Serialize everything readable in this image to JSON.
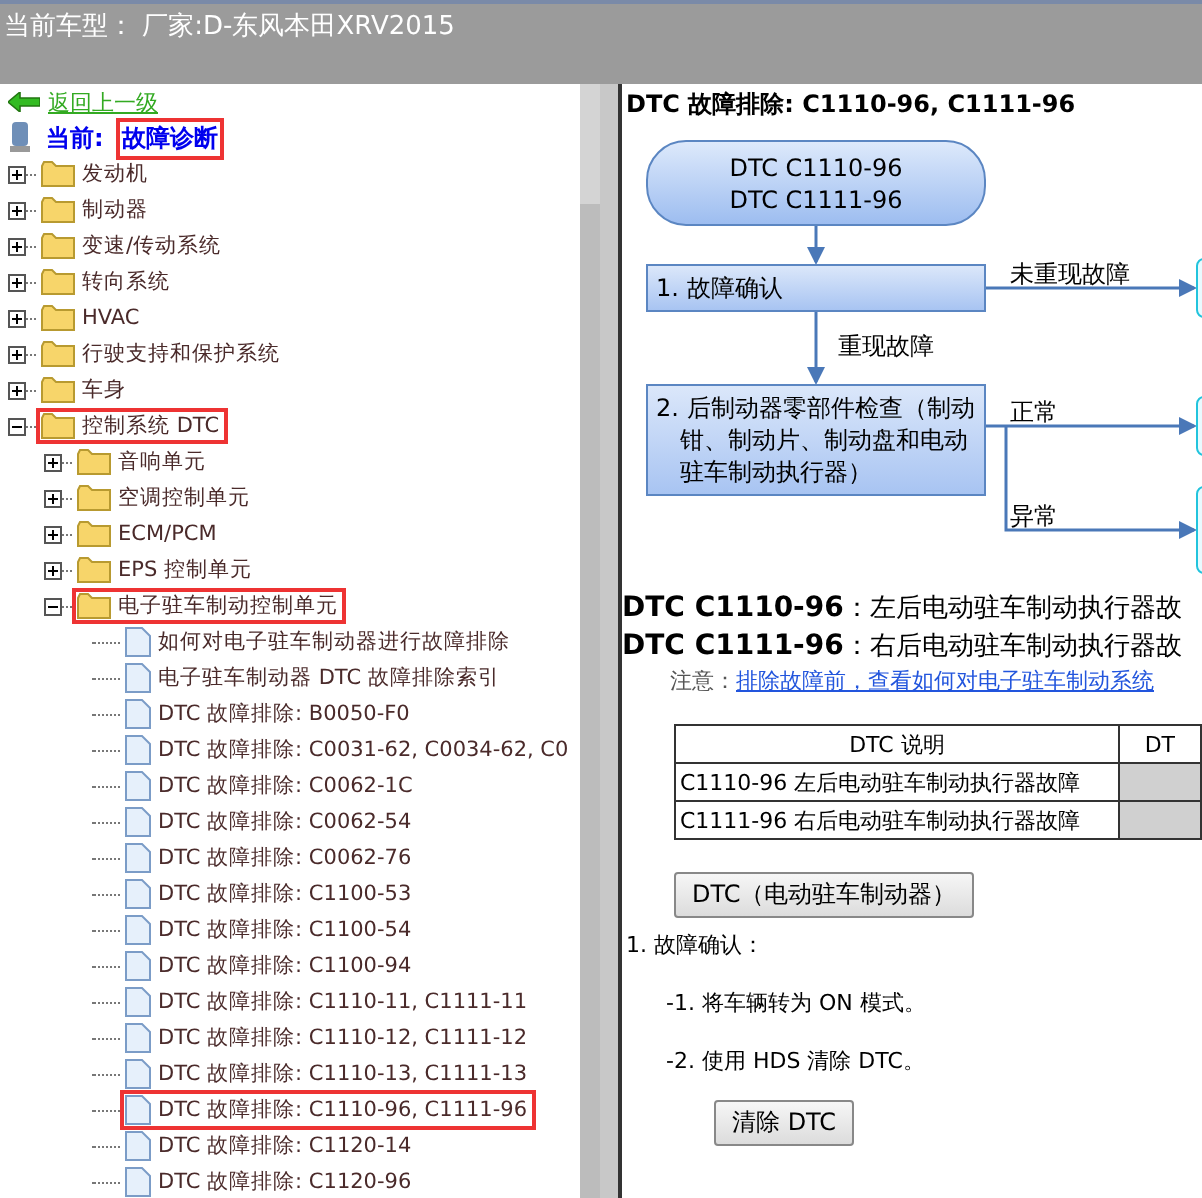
{
  "header": {
    "title": "当前车型：  厂家:D-东风本田XRV2015"
  },
  "nav": {
    "back": "返回上一级",
    "current_label": "当前:",
    "current_value": "故障诊断",
    "highlighted": true
  },
  "tree": [
    {
      "label": "发动机",
      "kind": "folder",
      "expanded": false,
      "highlighted": false
    },
    {
      "label": "制动器",
      "kind": "folder",
      "expanded": false,
      "highlighted": false
    },
    {
      "label": "变速/传动系统",
      "kind": "folder",
      "expanded": false,
      "highlighted": false
    },
    {
      "label": "转向系统",
      "kind": "folder",
      "expanded": false,
      "highlighted": false
    },
    {
      "label": "HVAC",
      "kind": "folder",
      "expanded": false,
      "highlighted": false
    },
    {
      "label": "行驶支持和保护系统",
      "kind": "folder",
      "expanded": false,
      "highlighted": false
    },
    {
      "label": "车身",
      "kind": "folder",
      "expanded": false,
      "highlighted": false
    },
    {
      "label": "控制系统 DTC",
      "kind": "folder",
      "expanded": true,
      "highlighted": true,
      "children": [
        {
          "label": "音响单元",
          "kind": "folder",
          "expanded": false,
          "highlighted": false
        },
        {
          "label": "空调控制单元",
          "kind": "folder",
          "expanded": false,
          "highlighted": false
        },
        {
          "label": "ECM/PCM",
          "kind": "folder",
          "expanded": false,
          "highlighted": false
        },
        {
          "label": "EPS 控制单元",
          "kind": "folder",
          "expanded": false,
          "highlighted": false
        },
        {
          "label": "电子驻车制动控制单元",
          "kind": "folder",
          "expanded": true,
          "highlighted": true,
          "children": [
            {
              "label": "如何对电子驻车制动器进行故障排除",
              "kind": "doc",
              "highlighted": false
            },
            {
              "label": "电子驻车制动器 DTC 故障排除索引",
              "kind": "doc",
              "highlighted": false
            },
            {
              "label": "DTC 故障排除: B0050-F0",
              "kind": "doc",
              "highlighted": false
            },
            {
              "label": "DTC 故障排除: C0031-62, C0034-62, C0",
              "kind": "doc",
              "highlighted": false
            },
            {
              "label": "DTC 故障排除: C0062-1C",
              "kind": "doc",
              "highlighted": false
            },
            {
              "label": "DTC 故障排除: C0062-54",
              "kind": "doc",
              "highlighted": false
            },
            {
              "label": "DTC 故障排除: C0062-76",
              "kind": "doc",
              "highlighted": false
            },
            {
              "label": "DTC 故障排除: C1100-53",
              "kind": "doc",
              "highlighted": false
            },
            {
              "label": "DTC 故障排除: C1100-54",
              "kind": "doc",
              "highlighted": false
            },
            {
              "label": "DTC 故障排除: C1100-94",
              "kind": "doc",
              "highlighted": false
            },
            {
              "label": "DTC 故障排除: C1110-11, C1111-11",
              "kind": "doc",
              "highlighted": false
            },
            {
              "label": "DTC 故障排除: C1110-12, C1111-12",
              "kind": "doc",
              "highlighted": false
            },
            {
              "label": "DTC 故障排除: C1110-13, C1111-13",
              "kind": "doc",
              "highlighted": false
            },
            {
              "label": "DTC 故障排除: C1110-96, C1111-96",
              "kind": "doc",
              "highlighted": true
            },
            {
              "label": "DTC 故障排除: C1120-14",
              "kind": "doc",
              "highlighted": false
            },
            {
              "label": "DTC 故障排除: C1120-96",
              "kind": "doc",
              "highlighted": false
            }
          ]
        }
      ]
    }
  ],
  "content": {
    "title": "DTC 故障排除: C1110-96, C1111-96",
    "flowchart": {
      "start": "DTC C1110-96\nDTC C1111-96",
      "step1": "1.  故障确认",
      "step1_no": "未重现故障",
      "step1_yes": "重现故障",
      "step2": "2.  后制动器零部件检查（制动钳、制动片、制动盘和电动驻车制动执行器）",
      "step2_ok": "正常",
      "step2_ng": "异常"
    },
    "definitions": [
      {
        "code": "DTC C1110-96",
        "text": "：左后电动驻车制动执行器故"
      },
      {
        "code": "DTC C1111-96",
        "text": "：右后电动驻车制动执行器故"
      }
    ],
    "note_label": "注意：",
    "note_link": "排除故障前，查看如何对电子驻车制动系统",
    "table": {
      "columns": [
        "DTC 说明",
        "DT"
      ],
      "rows": [
        [
          "C1110-96 左后电动驻车制动执行器故障"
        ],
        [
          "C1111-96 右后电动驻车制动执行器故障"
        ]
      ]
    },
    "dtc_button": "DTC（电动驻车制动器）",
    "step_title": "1.  故障确认：",
    "substeps": [
      "-1.   将车辆转为 ON 模式。",
      "-2.   使用 HDS 清除 DTC。"
    ],
    "clear_button": "清除 DTC"
  }
}
